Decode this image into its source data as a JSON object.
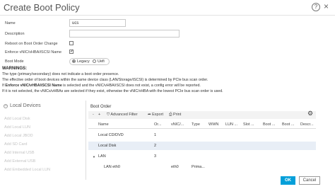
{
  "dialog": {
    "title": "Create Boot Policy",
    "help_glyph": "?",
    "close_glyph": "×"
  },
  "form": {
    "name_label": "Name",
    "name_value": "ucs",
    "description_label": "Description",
    "description_value": "",
    "reboot_label": "Reboot on Boot Order Change",
    "reboot_checked": false,
    "enforce_label": "Enforce vNIC/vHBA/iSCSI Name",
    "enforce_checked": true,
    "boot_mode_label": "Boot Mode",
    "boot_mode_options": [
      "Legacy",
      "Uefi"
    ],
    "boot_mode_selected": "Legacy"
  },
  "warnings": {
    "title": "WARNINGS:",
    "line1": "The type (primary/secondary) does not indicate a boot order presence.",
    "line2": "The effective order of boot devices within the same device class (LAN/Storage/iSCSI) is determined by PCIe bus scan order.",
    "line3_bold": "Enforce vNIC/vHBA/iSCSI Name",
    "line3_rest": " is selected and the vNIC/vHBA/iSCSI does not exist, a config error will be reported.",
    "line3_prefix": "If ",
    "line4": "If it is not selected, the vNICs/vHBAs are selected if they exist, otherwise the vNIC/vHBA with the lowest PCIe bus scan order is used."
  },
  "left_panel": {
    "header": "Local Devices",
    "items": [
      "Add Local Disk",
      "Add Local LUN",
      "Add Local JBOD",
      "Add SD Card",
      "Add Internal USB",
      "Add External USB",
      "Add Embedded Local LUN"
    ]
  },
  "boot_order": {
    "title": "Boot Order",
    "toolbar": {
      "collapse_all": "-",
      "expand_all": "+",
      "advanced_filter": "Advanced Filter",
      "export": "Export",
      "print": "Print"
    },
    "columns": [
      "Name",
      "Or...",
      "vNIC/...",
      "Type",
      "WWN",
      "LUN ...",
      "Slot ...",
      "Boot ...",
      "Boot ...",
      "Descr..."
    ],
    "rows": [
      {
        "name": "Local CD/DVD",
        "order": "1",
        "vnic": "",
        "type": ""
      },
      {
        "name": "Local Disk",
        "order": "2",
        "vnic": "",
        "type": ""
      },
      {
        "name": "LAN",
        "order": "3",
        "vnic": "",
        "type": ""
      },
      {
        "name": "LAN eth0",
        "order": "",
        "vnic": "eth0",
        "type": "Prima..."
      }
    ]
  },
  "buttons": {
    "ok": "OK",
    "cancel": "Cancel"
  },
  "colors": {
    "ok_button": "#049fd9",
    "selected_row": "#e8eef6"
  }
}
